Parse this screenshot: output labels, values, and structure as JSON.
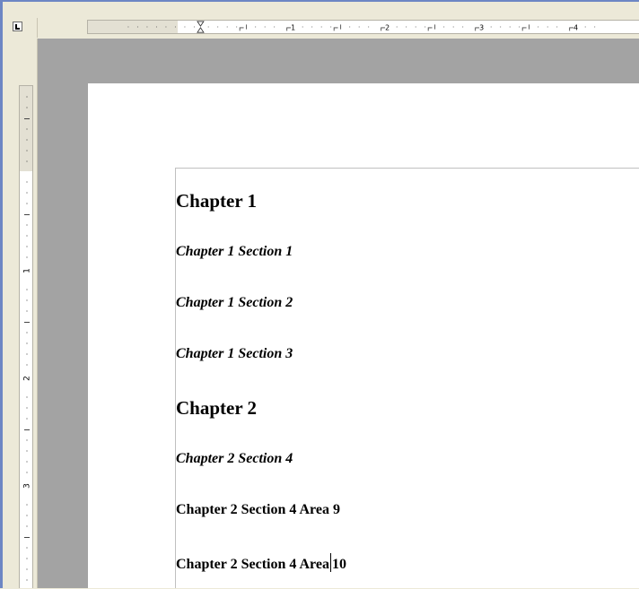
{
  "rulers": {
    "horizontal_numbers": [
      "1",
      "2",
      "3",
      "4"
    ],
    "vertical_numbers": [
      "1",
      "2",
      "3"
    ]
  },
  "document": {
    "headings": [
      {
        "text": "Chapter 1",
        "level": 1
      },
      {
        "text": "Chapter 1 Section 1",
        "level": 2
      },
      {
        "text": "Chapter 1 Section 2",
        "level": 2
      },
      {
        "text": "Chapter 1 Section 3",
        "level": 2
      },
      {
        "text": "Chapter 2",
        "level": 1
      },
      {
        "text": "Chapter 2 Section 4",
        "level": 2
      },
      {
        "text": "Chapter 2 Section 4 Area 9",
        "level": 3
      },
      {
        "text_before_cursor": "Chapter 2 Section 4 Area",
        "text_after_cursor": "10",
        "level": 3
      }
    ]
  },
  "colors": {
    "workspace": "#a3a3a3",
    "page": "#ffffff",
    "window_frame": "#6d86c4",
    "chrome": "#ece9d8"
  }
}
